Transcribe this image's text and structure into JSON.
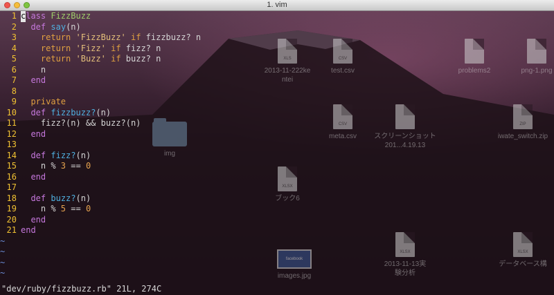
{
  "window": {
    "title": "1. vim"
  },
  "code": {
    "lines": [
      {
        "num": "1",
        "tokens": [
          {
            "t": "c",
            "k": "cur"
          },
          {
            "t": "lass ",
            "k": "k"
          },
          {
            "t": "FizzBuzz",
            "k": "c"
          }
        ]
      },
      {
        "num": "2",
        "tokens": [
          {
            "t": "  ",
            "k": "p"
          },
          {
            "t": "def",
            "k": "k"
          },
          {
            "t": " ",
            "k": "p"
          },
          {
            "t": "say",
            "k": "f"
          },
          {
            "t": "(n)",
            "k": "p"
          }
        ]
      },
      {
        "num": "3",
        "tokens": [
          {
            "t": "    ",
            "k": "p"
          },
          {
            "t": "return",
            "k": "e"
          },
          {
            "t": " ",
            "k": "p"
          },
          {
            "t": "'FizzBuzz'",
            "k": "s"
          },
          {
            "t": " ",
            "k": "p"
          },
          {
            "t": "if",
            "k": "e"
          },
          {
            "t": " fizzbuzz? n",
            "k": "p"
          }
        ]
      },
      {
        "num": "4",
        "tokens": [
          {
            "t": "    ",
            "k": "p"
          },
          {
            "t": "return",
            "k": "e"
          },
          {
            "t": " ",
            "k": "p"
          },
          {
            "t": "'Fizz'",
            "k": "s"
          },
          {
            "t": " ",
            "k": "p"
          },
          {
            "t": "if",
            "k": "e"
          },
          {
            "t": " fizz? n",
            "k": "p"
          }
        ]
      },
      {
        "num": "5",
        "tokens": [
          {
            "t": "    ",
            "k": "p"
          },
          {
            "t": "return",
            "k": "e"
          },
          {
            "t": " ",
            "k": "p"
          },
          {
            "t": "'Buzz'",
            "k": "s"
          },
          {
            "t": " ",
            "k": "p"
          },
          {
            "t": "if",
            "k": "e"
          },
          {
            "t": " buzz? n",
            "k": "p"
          }
        ]
      },
      {
        "num": "6",
        "tokens": [
          {
            "t": "    n",
            "k": "p"
          }
        ]
      },
      {
        "num": "7",
        "tokens": [
          {
            "t": "  ",
            "k": "p"
          },
          {
            "t": "end",
            "k": "k"
          }
        ]
      },
      {
        "num": "8",
        "tokens": []
      },
      {
        "num": "9",
        "tokens": [
          {
            "t": "  ",
            "k": "p"
          },
          {
            "t": "private",
            "k": "e"
          }
        ]
      },
      {
        "num": "10",
        "tokens": [
          {
            "t": "  ",
            "k": "p"
          },
          {
            "t": "def",
            "k": "k"
          },
          {
            "t": " ",
            "k": "p"
          },
          {
            "t": "fizzbuzz?",
            "k": "f"
          },
          {
            "t": "(n)",
            "k": "p"
          }
        ]
      },
      {
        "num": "11",
        "tokens": [
          {
            "t": "    fizz?(n) && buzz?(n)",
            "k": "p"
          }
        ]
      },
      {
        "num": "12",
        "tokens": [
          {
            "t": "  ",
            "k": "p"
          },
          {
            "t": "end",
            "k": "k"
          }
        ]
      },
      {
        "num": "13",
        "tokens": []
      },
      {
        "num": "14",
        "tokens": [
          {
            "t": "  ",
            "k": "p"
          },
          {
            "t": "def",
            "k": "k"
          },
          {
            "t": " ",
            "k": "p"
          },
          {
            "t": "fizz?",
            "k": "f"
          },
          {
            "t": "(n)",
            "k": "p"
          }
        ]
      },
      {
        "num": "15",
        "tokens": [
          {
            "t": "    n % ",
            "k": "p"
          },
          {
            "t": "3",
            "k": "n"
          },
          {
            "t": " == ",
            "k": "p"
          },
          {
            "t": "0",
            "k": "n"
          }
        ]
      },
      {
        "num": "16",
        "tokens": [
          {
            "t": "  ",
            "k": "p"
          },
          {
            "t": "end",
            "k": "k"
          }
        ]
      },
      {
        "num": "17",
        "tokens": []
      },
      {
        "num": "18",
        "tokens": [
          {
            "t": "  ",
            "k": "p"
          },
          {
            "t": "def",
            "k": "k"
          },
          {
            "t": " ",
            "k": "p"
          },
          {
            "t": "buzz?",
            "k": "f"
          },
          {
            "t": "(n)",
            "k": "p"
          }
        ]
      },
      {
        "num": "19",
        "tokens": [
          {
            "t": "    n % ",
            "k": "p"
          },
          {
            "t": "5",
            "k": "n"
          },
          {
            "t": " == ",
            "k": "p"
          },
          {
            "t": "0",
            "k": "n"
          }
        ]
      },
      {
        "num": "20",
        "tokens": [
          {
            "t": "  ",
            "k": "p"
          },
          {
            "t": "end",
            "k": "k"
          }
        ]
      },
      {
        "num": "21",
        "tokens": [
          {
            "t": "end",
            "k": "k"
          }
        ]
      }
    ],
    "tildes": [
      "~",
      "~",
      "~",
      "~"
    ]
  },
  "status_line": "\"dev/ruby/fizzbuzz.rb\" 21L, 274C",
  "desktop_icons": [
    {
      "label": "2013-11-222ke\nntei",
      "kind": "doc",
      "ext": "XLS"
    },
    {
      "label": "test.csv",
      "kind": "doc",
      "ext": "CSV"
    },
    {
      "label": "problems2",
      "kind": "doc",
      "ext": ""
    },
    {
      "label": "png-1.png",
      "kind": "doc",
      "ext": ""
    },
    {
      "label": "img",
      "kind": "folder",
      "ext": ""
    },
    {
      "label": "meta.csv",
      "kind": "doc",
      "ext": "CSV"
    },
    {
      "label": "スクリーンショット\n201...4.19.13",
      "kind": "doc",
      "ext": ""
    },
    {
      "label": "iwate_switch.zip",
      "kind": "doc",
      "ext": "ZIP"
    },
    {
      "label": "ブック6",
      "kind": "doc",
      "ext": "XLSX"
    },
    {
      "label": "2013-11-13実\n験分析",
      "kind": "doc",
      "ext": "XLSX"
    },
    {
      "label": "データベース構",
      "kind": "doc",
      "ext": "XLSX"
    },
    {
      "label": "images.jpg",
      "kind": "image",
      "ext": "facebook"
    }
  ]
}
